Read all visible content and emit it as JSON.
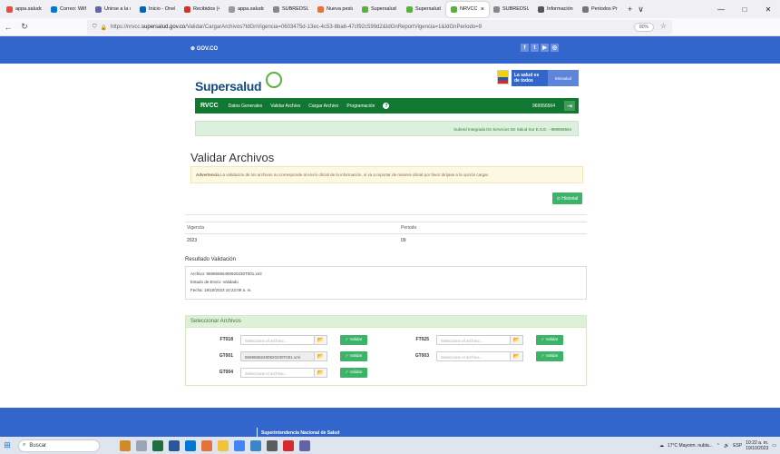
{
  "browser": {
    "tabs": [
      {
        "label": "appa.saludcapital",
        "color": "#e74c3c"
      },
      {
        "label": "Correo: Wilfre",
        "color": "#0078d4"
      },
      {
        "label": "Unirse a la co",
        "color": "#6264a7"
      },
      {
        "label": "Inicio - OneD",
        "color": "#0364b8"
      },
      {
        "label": "Recibidos (49",
        "color": "#d93025"
      },
      {
        "label": "appa.saludcapital",
        "color": "#999999"
      },
      {
        "label": "SUBREDSUR",
        "color": "#888888"
      },
      {
        "label": "Nueva pestañ",
        "color": "#e8703a"
      },
      {
        "label": "Supersalud",
        "color": "#5ab13c"
      },
      {
        "label": "Supersalud |",
        "color": "#5ab13c"
      },
      {
        "label": "NRVCC",
        "color": "#5ab13c"
      },
      {
        "label": "SUBREDSUR",
        "color": "#888888"
      },
      {
        "label": "Información",
        "color": "#555555"
      },
      {
        "label": "Periodos Presenta",
        "color": "#777777"
      }
    ],
    "active_tab_close": "×",
    "new_tab": "+",
    "tab_list": "∨",
    "url_prefix": "https://nrvcc.",
    "url_domain": "supersalud.gov.co",
    "url_path": "/Validar/CargarArchivos?IdGnVigencia=0603475d-13ec-4c53-8ba6-47cf92c599d2&IdGnReportVigencia=1&IdGnPeriodo=9",
    "zoom": "80%",
    "minimize": "—",
    "maximize": "□",
    "close": "✕"
  },
  "gov_header": {
    "logo": "⊛ GOV.CO",
    "social": [
      "f",
      "t",
      "▶",
      "◎"
    ]
  },
  "brand": {
    "logo_text": "Supersalud",
    "lasalud": "La salud es de todos",
    "minsalud": "Minsalud"
  },
  "menu": {
    "app_name": "RVCC",
    "items": [
      "Datos Generales",
      "Validar Archivo",
      "Cargar Archivo",
      "Programación"
    ],
    "help": "?",
    "entity_code": "969956564",
    "exit": "⇥"
  },
  "entity_banner": "Subred Integrada De Servicios De Salud Sur E.S.E. - 969956564",
  "page": {
    "title": "Validar Archivos",
    "warning_label": "Advertencia",
    "warning_text": " La validación de los archivos no corresponde al envío oficial de la información, si va a reportar de manera oficial por favor diríjase a la opción cargar.",
    "history_button": "⊙ Historial"
  },
  "info": {
    "vigencia_label": "Vigencia",
    "periodo_label": "Periodo",
    "vigencia_value": "2023",
    "periodo_value": "09"
  },
  "result": {
    "header": "Resultado Validación",
    "archivo": "Archivo: 96995656490920230T001.xml",
    "estado": "Estado de Envío: Validado",
    "fecha": "Fecha: 19/10/2023 10:22:09 a. m."
  },
  "files": {
    "panel_title": "Seleccionar Archivos",
    "placeholder": "Seleccione el archivo...",
    "validate_label": "✓ Validar",
    "browse_icon": "📂",
    "rows": [
      {
        "label": "FT018",
        "value": ""
      },
      {
        "label": "FT025",
        "value": ""
      },
      {
        "label": "GT001",
        "value": "96995656490920230T001.xml"
      },
      {
        "label": "GT003",
        "value": ""
      },
      {
        "label": "GT004",
        "value": ""
      }
    ]
  },
  "footer": {
    "title": "Superintendencia Nacional de Salud"
  },
  "taskbar": {
    "search": "Buscar",
    "weather": "17°C Mayorm. nubla...",
    "lang": "ESP",
    "time": "10:22 a. m.",
    "date": "19/10/2023"
  }
}
